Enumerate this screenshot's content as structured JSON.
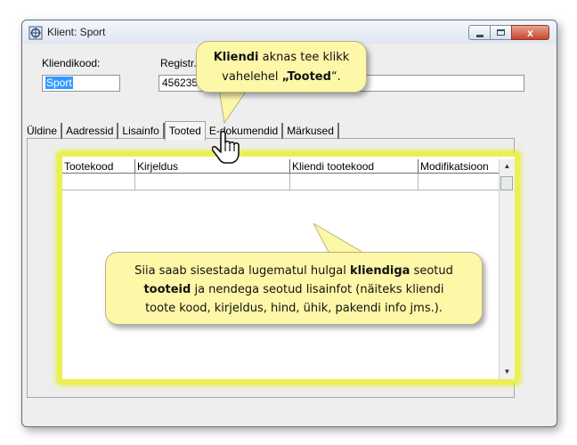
{
  "window": {
    "title": "Klient: Sport",
    "close_glyph": "x"
  },
  "fields": {
    "kliendikood_label": "Kliendikood:",
    "kliendikood_value": "Sport",
    "registr_label": "Registr.",
    "registr_value": "456235"
  },
  "tabs": [
    "Üldine",
    "Aadressid",
    "Lisainfo",
    "Tooted",
    "E-dokumendid",
    "Märkused"
  ],
  "active_tab": "Tooted",
  "grid": {
    "columns": [
      "Tootekood",
      "Kirjeldus",
      "Kliendi tootekood",
      "Modifikatsioon"
    ]
  },
  "callout1": {
    "bold1": "Kliendi",
    "text1": " aknas tee klikk",
    "text2": "vahelehel ",
    "quote_open": "„",
    "bold2": "Tooted",
    "quote_close": "“."
  },
  "callout2": {
    "t1": "Siia saab sisestada lugematul hulgal ",
    "b1": "kliendiga",
    "t2": " seotud",
    "b2": "tooteid",
    "t3": " ja nendega seotud lisainfot (näiteks kliendi",
    "t4": "toote kood, kirjeldus, hind, ühik, pakendi info jms.)."
  },
  "colors": {
    "highlight": "#ecf050",
    "callout_bg": "#fdf7a8",
    "selection": "#3399ff"
  },
  "icons": [
    "app-icon",
    "minimize-icon",
    "maximize-icon",
    "close-icon",
    "pointer-hand-icon",
    "scroll-up-icon",
    "scroll-down-icon"
  ]
}
